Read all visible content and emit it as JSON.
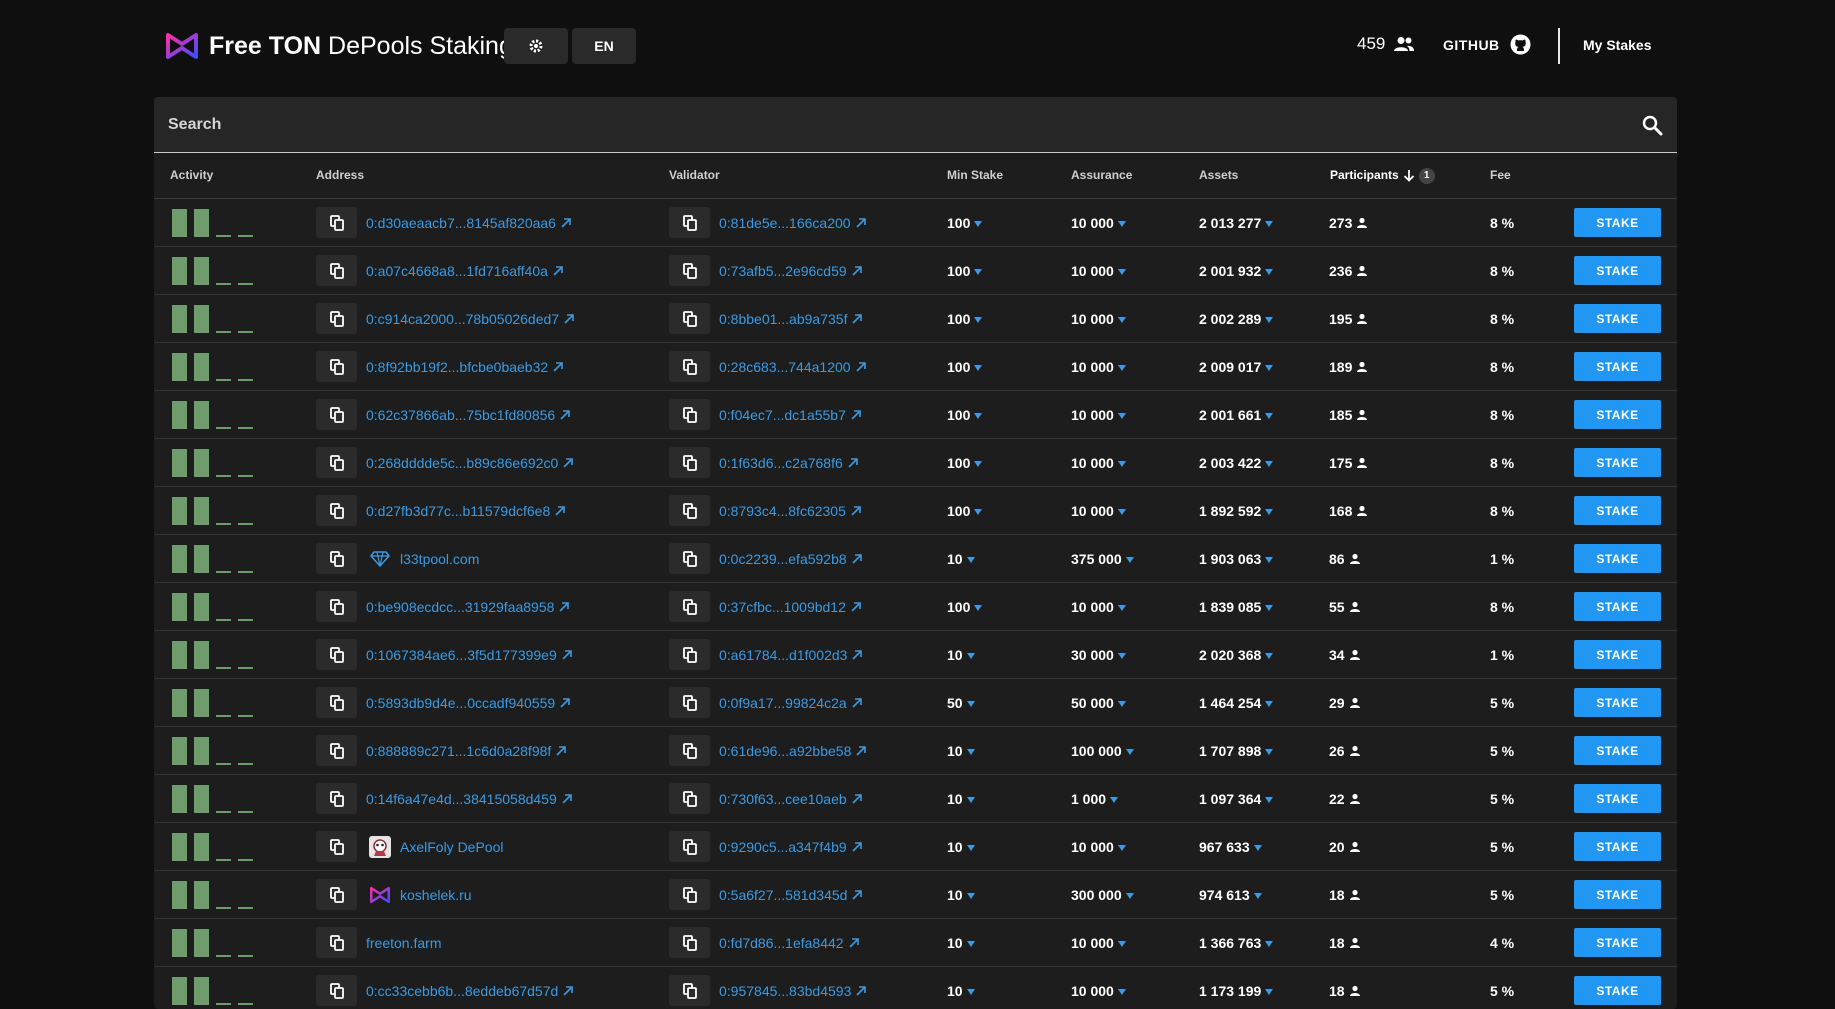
{
  "header": {
    "brand_bold": "Free TON",
    "brand_light": "DePools Staking",
    "lang": "EN",
    "online_count": "459",
    "github": "GITHUB",
    "my_stakes": "My Stakes"
  },
  "search": {
    "placeholder": "Search"
  },
  "columns": {
    "activity": "Activity",
    "address": "Address",
    "validator": "Validator",
    "min_stake": "Min Stake",
    "assurance": "Assurance",
    "assets": "Assets",
    "participants": "Participants",
    "participants_sort_index": "1",
    "fee": "Fee"
  },
  "stake_label": "STAKE",
  "colors": {
    "accent": "#2196f3",
    "link": "#3d9ae2",
    "activity_bar": "#6f9c6c"
  },
  "rows": [
    {
      "address": "0:d30aeaacb7...8145af820aa6",
      "address_type": "address",
      "validator": "0:81de5e...166ca200",
      "min_stake": "100",
      "assurance": "10 000",
      "assets": "2 013 277",
      "participants": "273",
      "fee": "8 %"
    },
    {
      "address": "0:a07c4668a8...1fd716aff40a",
      "address_type": "address",
      "validator": "0:73afb5...2e96cd59",
      "min_stake": "100",
      "assurance": "10 000",
      "assets": "2 001 932",
      "participants": "236",
      "fee": "8 %"
    },
    {
      "address": "0:c914ca2000...78b05026ded7",
      "address_type": "address",
      "validator": "0:8bbe01...ab9a735f",
      "min_stake": "100",
      "assurance": "10 000",
      "assets": "2 002 289",
      "participants": "195",
      "fee": "8 %"
    },
    {
      "address": "0:8f92bb19f2...bfcbe0baeb32",
      "address_type": "address",
      "validator": "0:28c683...744a1200",
      "min_stake": "100",
      "assurance": "10 000",
      "assets": "2 009 017",
      "participants": "189",
      "fee": "8 %"
    },
    {
      "address": "0:62c37866ab...75bc1fd80856",
      "address_type": "address",
      "validator": "0:f04ec7...dc1a55b7",
      "min_stake": "100",
      "assurance": "10 000",
      "assets": "2 001 661",
      "participants": "185",
      "fee": "8 %"
    },
    {
      "address": "0:268dddde5c...b89c86e692c0",
      "address_type": "address",
      "validator": "0:1f63d6...c2a768f6",
      "min_stake": "100",
      "assurance": "10 000",
      "assets": "2 003 422",
      "participants": "175",
      "fee": "8 %"
    },
    {
      "address": "0:d27fb3d77c...b11579dcf6e8",
      "address_type": "address",
      "validator": "0:8793c4...8fc62305",
      "min_stake": "100",
      "assurance": "10 000",
      "assets": "1 892 592",
      "participants": "168",
      "fee": "8 %"
    },
    {
      "address": "l33tpool.com",
      "address_type": "name",
      "name_icon": "diamond-icon",
      "validator": "0:0c2239...efa592b8",
      "min_stake": "10",
      "assurance": "375 000",
      "assets": "1 903 063",
      "participants": "86",
      "fee": "1 %"
    },
    {
      "address": "0:be908ecdcc...31929faa8958",
      "address_type": "address",
      "validator": "0:37cfbc...1009bd12",
      "min_stake": "100",
      "assurance": "10 000",
      "assets": "1 839 085",
      "participants": "55",
      "fee": "8 %"
    },
    {
      "address": "0:1067384ae6...3f5d177399e9",
      "address_type": "address",
      "validator": "0:a61784...d1f002d3",
      "min_stake": "10",
      "assurance": "30 000",
      "assets": "2 020 368",
      "participants": "34",
      "fee": "1 %"
    },
    {
      "address": "0:5893db9d4e...0ccadf940559",
      "address_type": "address",
      "validator": "0:0f9a17...99824c2a",
      "min_stake": "50",
      "assurance": "50 000",
      "assets": "1 464 254",
      "participants": "29",
      "fee": "5 %"
    },
    {
      "address": "0:888889c271...1c6d0a28f98f",
      "address_type": "address",
      "validator": "0:61de96...a92bbe58",
      "min_stake": "10",
      "assurance": "100 000",
      "assets": "1 707 898",
      "participants": "26",
      "fee": "5 %"
    },
    {
      "address": "0:14f6a47e4d...38415058d459",
      "address_type": "address",
      "validator": "0:730f63...cee10aeb",
      "min_stake": "10",
      "assurance": "1 000",
      "assets": "1 097 364",
      "participants": "22",
      "fee": "5 %"
    },
    {
      "address": "AxelFoly DePool",
      "address_type": "name",
      "name_icon": "avatar-icon",
      "validator": "0:9290c5...a347f4b9",
      "min_stake": "10",
      "assurance": "10 000",
      "assets": "967 633",
      "participants": "20",
      "fee": "5 %"
    },
    {
      "address": "koshelek.ru",
      "address_type": "name",
      "name_icon": "ton-logo-icon",
      "validator": "0:5a6f27...581d345d",
      "min_stake": "10",
      "assurance": "300 000",
      "assets": "974 613",
      "participants": "18",
      "fee": "5 %"
    },
    {
      "address": "freeton.farm",
      "address_type": "name",
      "name_icon": "",
      "validator": "0:fd7d86...1efa8442",
      "min_stake": "10",
      "assurance": "10 000",
      "assets": "1 366 763",
      "participants": "18",
      "fee": "4 %"
    },
    {
      "address": "0:cc33cebb6b...8eddeb67d57d",
      "address_type": "address",
      "validator": "0:957845...83bd4593",
      "min_stake": "10",
      "assurance": "10 000",
      "assets": "1 173 199",
      "participants": "18",
      "fee": "5 %"
    }
  ]
}
